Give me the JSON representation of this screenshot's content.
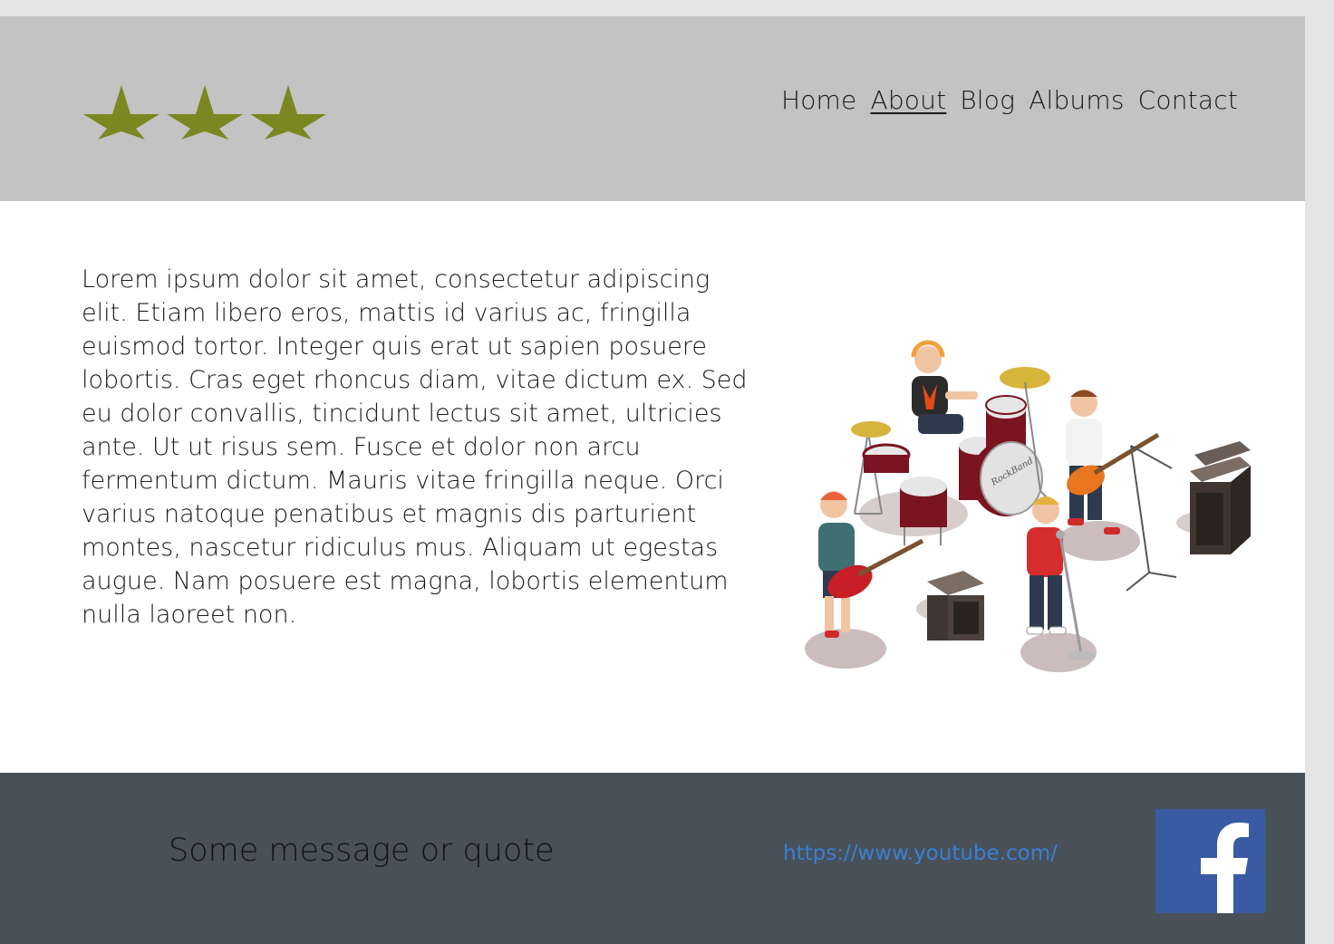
{
  "header": {
    "logo_icon": "three-stars",
    "logo_color": "#7b8720",
    "nav": [
      {
        "label": "Home"
      },
      {
        "label": "About",
        "active": true
      },
      {
        "label": "Blog"
      },
      {
        "label": "Albums"
      },
      {
        "label": "Contact"
      }
    ]
  },
  "main": {
    "body_text": "Lorem ipsum dolor sit amet, consectetur adipiscing elit. Etiam libero eros, mattis id varius ac, fringilla euismod tortor. Integer quis erat ut sapien posuere lobortis. Cras eget rhoncus diam, vitae dictum ex. Sed eu dolor convallis, tincidunt lectus sit amet, ultricies ante. Ut ut risus sem. Fusce et dolor non arcu fermentum dictum. Mauris vitae fringilla neque. Orci varius natoque penatibus et magnis dis parturient montes, nascetur ridiculus mus. Aliquam ut egestas augue. Nam posuere est magna, lobortis elementum nulla laoreet non.",
    "illustration_icon": "rock-band-illustration",
    "drum_text": "RockBand"
  },
  "footer": {
    "quote": "Some message or quote",
    "link_text": "https://www.youtube.com/",
    "social_icon": "facebook-icon",
    "facebook_color": "#3b5aa4",
    "background_color": "#475157"
  }
}
